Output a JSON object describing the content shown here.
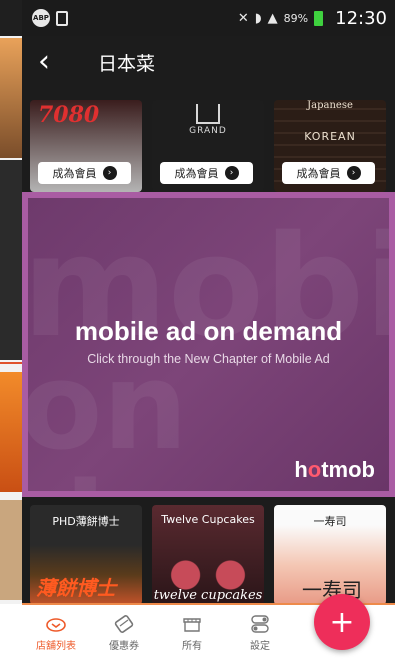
{
  "status_bar": {
    "abp_label": "ABP",
    "battery_pct": "89%",
    "time": "12:30"
  },
  "app_bar": {
    "title": "日本菜"
  },
  "stores": [
    {
      "logo": "7080",
      "cta": "成為會員"
    },
    {
      "logo": "GRAND",
      "cta": "成為會員"
    },
    {
      "logo": "Japanese",
      "sub": "KOREAN",
      "cta": "成為會員"
    }
  ],
  "ad": {
    "headline": "mobile ad on demand",
    "subline": "Click through the New Chapter of Mobile Ad",
    "brand_a": "h",
    "brand_b": "o",
    "brand_c": "tmob"
  },
  "restaurants": [
    {
      "name": "PHD薄餅博士",
      "badge": "薄餅博士"
    },
    {
      "name": "Twelve Cupcakes",
      "badge": "twelve cupcakes"
    },
    {
      "name": "一寿司",
      "badge": "一寿司"
    }
  ],
  "bottom_nav": {
    "items": [
      {
        "label": "店舖列表",
        "icon": "store-list-icon",
        "active": true
      },
      {
        "label": "優惠券",
        "icon": "coupon-icon",
        "active": false
      },
      {
        "label": "所有",
        "icon": "shop-icon",
        "active": false
      },
      {
        "label": "設定",
        "icon": "settings-toggle-icon",
        "active": false
      }
    ],
    "fab_label": "+"
  },
  "colors": {
    "accent": "#ee5a2a",
    "fab": "#ee2e5a",
    "ad_frame": "#a95ca3"
  }
}
